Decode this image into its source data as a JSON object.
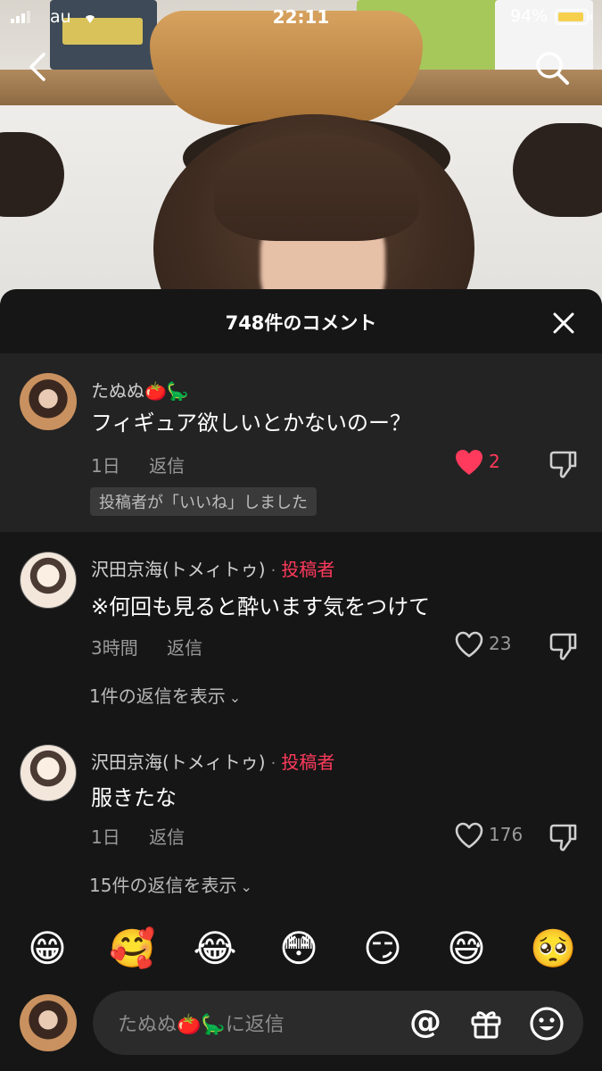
{
  "status_bar": {
    "carrier": "au",
    "time": "22:11",
    "battery_percent": "94%",
    "battery_level": 0.94,
    "battery_color": "#f6d04d"
  },
  "video": {
    "back_icon": "chevron-left-icon",
    "search_icon": "search-icon"
  },
  "sheet": {
    "title": "748件のコメント",
    "close_icon": "close-icon"
  },
  "comments": [
    {
      "username": "たぬぬ🍅🦕",
      "text": "フィギュア欲しいとかないのー？",
      "age": "1日",
      "reply_label": "返信",
      "likes": "2",
      "liked": true,
      "creator_liked": "投稿者が「いいね」しました"
    },
    {
      "username": "沢田京海(トメィトゥ)",
      "separator": "·",
      "author_tag": "投稿者",
      "text": "※何回も見ると酔います気をつけて",
      "age": "3時間",
      "reply_label": "返信",
      "likes": "23",
      "liked": false,
      "view_replies": "1件の返信を表示"
    },
    {
      "username": "沢田京海(トメィトゥ)",
      "separator": "·",
      "author_tag": "投稿者",
      "text": "服きたな",
      "age": "1日",
      "reply_label": "返信",
      "likes": "176",
      "liked": false,
      "view_replies": "15件の返信を表示"
    }
  ],
  "emoji_bar": [
    "😁",
    "🥰",
    "😂",
    "😳",
    "😏",
    "😅",
    "🥺"
  ],
  "input": {
    "placeholder": "たぬぬ🍅🦕に返信",
    "at_label": "@",
    "gift_icon": "gift-icon",
    "emoji_icon": "smiley-icon"
  },
  "colors": {
    "accent_red": "#ff3a5c",
    "sheet_bg": "#161616",
    "highlight_bg": "#232323"
  }
}
